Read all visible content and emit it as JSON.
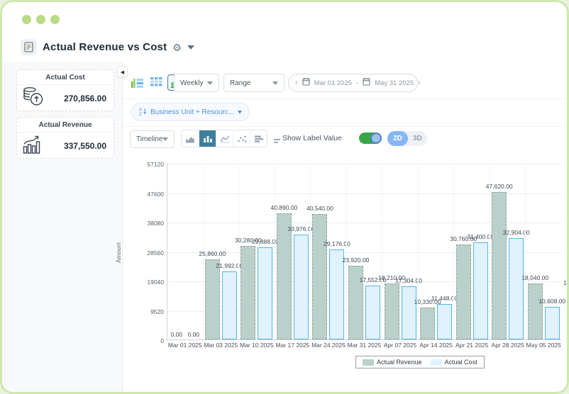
{
  "window": {
    "dots": [
      "",
      "",
      ""
    ]
  },
  "header": {
    "title": "Actual Revenue vs Cost"
  },
  "sidebar": {
    "cards": [
      {
        "title": "Actual Cost",
        "value": "270,856.00",
        "icon": "coins-icon"
      },
      {
        "title": "Actual Revenue",
        "value": "337,550.00",
        "icon": "growth-chart-icon"
      }
    ]
  },
  "toolbar": {
    "view_icons": [
      "chart-table-view-icon",
      "grid-view-icon",
      "bar-chart-view-icon"
    ],
    "frequency": {
      "value": "Weekly"
    },
    "range": {
      "value": "Range"
    },
    "date_range": {
      "prev": "‹",
      "start": "Mar 01 2025",
      "separator": "-",
      "end": "May 31 2025",
      "next": "›"
    },
    "group_chip": {
      "label": "Business Unit + Resourc..."
    },
    "timeline": {
      "value": "Timeline"
    },
    "chart_types": [
      "area-chart-icon",
      "bar-chart-icon",
      "line-chart-icon",
      "scatter-chart-icon",
      "hbar-chart-icon"
    ],
    "show_label_value": {
      "label": "Show Label Value",
      "enabled": true
    },
    "dimension": {
      "options": [
        "2D",
        "3D"
      ],
      "selected": "2D"
    }
  },
  "chart_data": {
    "type": "bar",
    "title": "",
    "xlabel": "",
    "ylabel": "Amount",
    "ylim": [
      0,
      57120
    ],
    "yticks": [
      0,
      9520,
      19040,
      28560,
      38080,
      47600,
      57120
    ],
    "grid": true,
    "legend_position": "bottom",
    "categories": [
      "Mar 01 2025",
      "Mar 03 2025",
      "Mar 10 2025",
      "Mar 17 2025",
      "Mar 24 2025",
      "Mar 31 2025",
      "Apr 07 2025",
      "Apr 14 2025",
      "Apr 21 2025",
      "Apr 28 2025",
      "May 05 2025"
    ],
    "series": [
      {
        "name": "Actual Revenue",
        "color": "#bad0ca",
        "border_color": "#93a5a0",
        "values": [
          0,
          25860,
          30280,
          40890,
          40540,
          23920,
          18210,
          10330,
          30760,
          47620,
          18040
        ]
      },
      {
        "name": "Actual Cost",
        "color": "#dff2fd",
        "border_color": "#54b5e9",
        "values": [
          0,
          21992,
          29888,
          33976,
          29176,
          17552,
          17304,
          11448,
          31400,
          32904,
          10608
        ]
      }
    ],
    "clipped_right_label": "1"
  },
  "colors": {
    "frame_green": "#cfe7ad",
    "dot_green": "#b9dc84",
    "accent_blue": "#4a90e2",
    "toggle_on_green": "#38a547",
    "active_segment_teal": "#3e7e9b",
    "dimension_active_blue": "#86b6f3"
  }
}
